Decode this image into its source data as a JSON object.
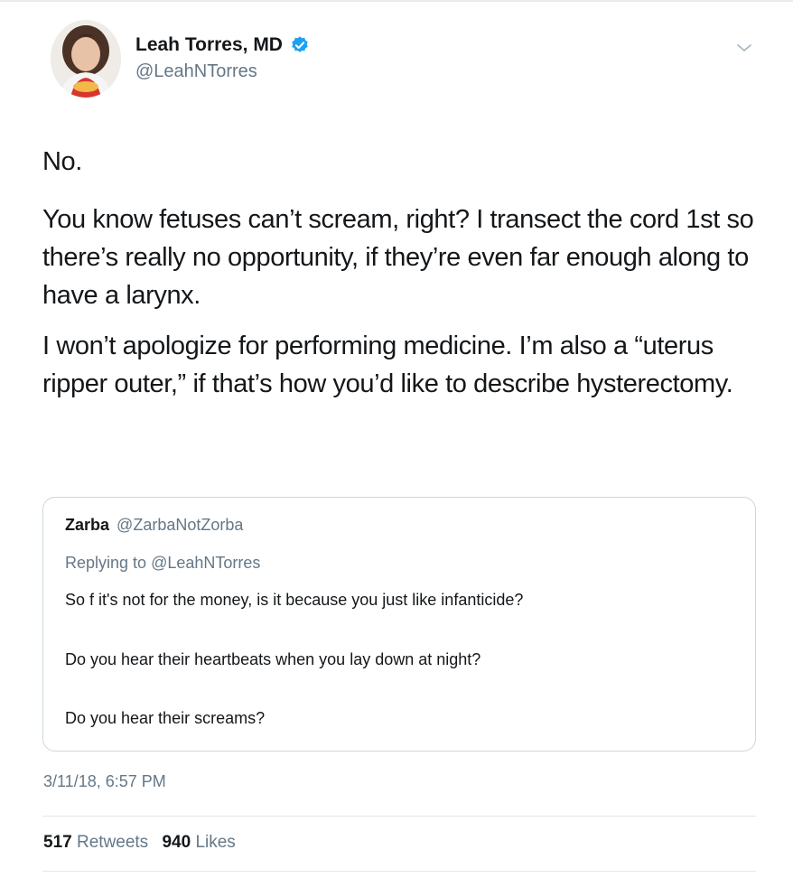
{
  "author": {
    "display_name": "Leah Torres, MD",
    "handle": "@LeahNTorres",
    "verified": true
  },
  "tweet": {
    "paragraphs": [
      "No.",
      "You know fetuses can’t scream, right? I transect the cord 1st so there’s really no opportunity, if they’re even far enough along to have a larynx.",
      "I won’t apologize for performing medicine. I’m also a “uterus ripper outer,” if that’s how you’d like to describe hysterectomy."
    ],
    "timestamp": "3/11/18, 6:57 PM"
  },
  "quoted_tweet": {
    "display_name": "Zarba",
    "handle": "@ZarbaNotZorba",
    "replying_prefix": "Replying to",
    "replying_to": "@LeahNTorres",
    "lines": [
      "So f it's not for the money, is it because you just like infanticide?",
      "Do you hear their heartbeats when you lay down at night?",
      "Do you hear their screams?"
    ]
  },
  "stats": {
    "retweets_count": "517",
    "retweets_label": "Retweets",
    "likes_count": "940",
    "likes_label": "Likes"
  },
  "colors": {
    "verified_badge": "#1da1f2",
    "secondary_text": "#657786",
    "border": "#ccd6dd"
  },
  "icons": {
    "verified": "verified-badge-icon",
    "menu": "chevron-down-icon"
  }
}
